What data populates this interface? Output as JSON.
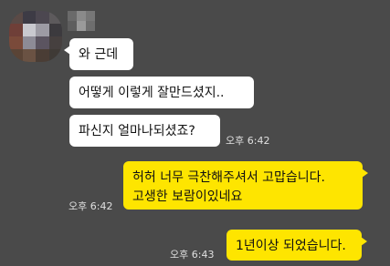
{
  "sender": {
    "avatar_icon": "blurred-profile-photo",
    "name_icon": "blurred-sender-name"
  },
  "messages": [
    {
      "direction": "in",
      "text": "와 근데"
    },
    {
      "direction": "in",
      "text": "어떻게 이렇게 잘만드셨지.."
    },
    {
      "direction": "in",
      "text": "파신지 얼마나되셨죠?",
      "time": "오후 6:42"
    },
    {
      "direction": "out",
      "line1": "허허 너무 극찬해주셔서 고맙습니다.",
      "line2": "고생한 보람이있네요",
      "time": "오후 6:42"
    },
    {
      "direction": "out",
      "text": "1년이상 되었습니다.",
      "time": "오후 6:43"
    }
  ],
  "colors": {
    "background": "#4a4a4a",
    "incoming_bubble": "#ffffff",
    "outgoing_bubble": "#fee500",
    "timestamp": "#e0e0e0"
  }
}
